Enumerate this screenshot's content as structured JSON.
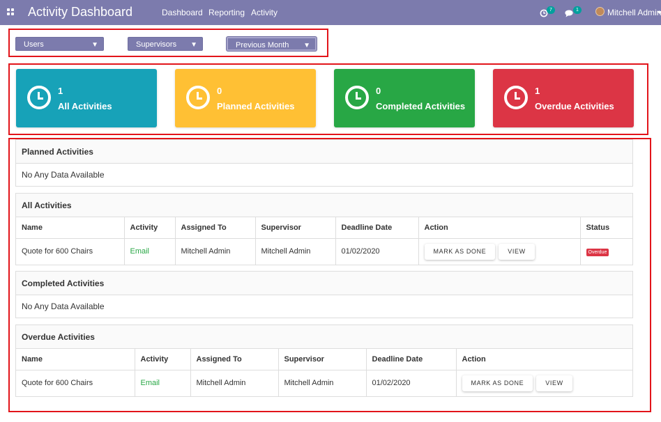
{
  "topbar": {
    "title": "Activity Dashboard",
    "menu": [
      "Dashboard",
      "Reporting",
      "Activity"
    ],
    "activity_count": "7",
    "message_count": "1",
    "user": "Mitchell Admin"
  },
  "filters": {
    "users": "Users",
    "supervisors": "Supervisors",
    "period": "Previous Month"
  },
  "cards": [
    {
      "count": "1",
      "label": "All Activities",
      "color": "#17a2b8"
    },
    {
      "count": "0",
      "label": "Planned Activities",
      "color": "#ffc034"
    },
    {
      "count": "0",
      "label": "Completed Activities",
      "color": "#28a745"
    },
    {
      "count": "1",
      "label": "Overdue Activities",
      "color": "#dc3545"
    }
  ],
  "planned": {
    "title": "Planned Activities",
    "empty": "No Any Data Available"
  },
  "all": {
    "title": "All Activities",
    "columns": [
      "Name",
      "Activity",
      "Assigned To",
      "Supervisor",
      "Deadline Date",
      "Action",
      "Status"
    ],
    "rows": [
      {
        "name": "Quote for 600 Chairs",
        "activity": "Email",
        "assigned": "Mitchell Admin",
        "supervisor": "Mitchell Admin",
        "deadline": "01/02/2020",
        "mark_done": "MARK AS DONE",
        "view": "VIEW",
        "status": "Overdue"
      }
    ]
  },
  "completed": {
    "title": "Completed Activities",
    "empty": "No Any Data Available"
  },
  "overdue": {
    "title": "Overdue Activities",
    "columns": [
      "Name",
      "Activity",
      "Assigned To",
      "Supervisor",
      "Deadline Date",
      "Action"
    ],
    "rows": [
      {
        "name": "Quote for 600 Chairs",
        "activity": "Email",
        "assigned": "Mitchell Admin",
        "supervisor": "Mitchell Admin",
        "deadline": "01/02/2020",
        "mark_done": "MARK AS DONE",
        "view": "VIEW"
      }
    ]
  }
}
